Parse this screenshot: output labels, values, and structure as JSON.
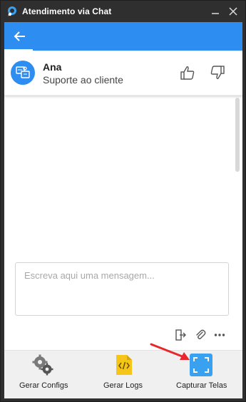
{
  "window": {
    "title": "Atendimento via Chat",
    "minimize_icon": "minimize-icon",
    "close_icon": "close-icon"
  },
  "navbar": {
    "back_icon": "arrow-left-icon",
    "color": "#2e8df0"
  },
  "agent": {
    "name": "Ana",
    "role": "Suporte ao cliente",
    "avatar_icon": "support-chat-icon",
    "rate_up_icon": "thumbs-up-icon",
    "rate_down_icon": "thumbs-down-icon"
  },
  "composer": {
    "placeholder": "Escreva aqui uma mensagem...",
    "value": "",
    "actions": [
      "exit-icon",
      "paperclip-icon",
      "more-icon"
    ]
  },
  "toolbar": {
    "items": [
      {
        "label": "Gerar Configs",
        "icon": "gear-icon"
      },
      {
        "label": "Gerar Logs",
        "icon": "code-file-icon"
      },
      {
        "label": "Capturar Telas",
        "icon": "screen-capture-icon"
      }
    ]
  },
  "colors": {
    "accent": "#2e8df0",
    "titlebar": "#2f2f2f",
    "annotation_arrow": "#e8262b",
    "log_icon": "#f5c518"
  }
}
